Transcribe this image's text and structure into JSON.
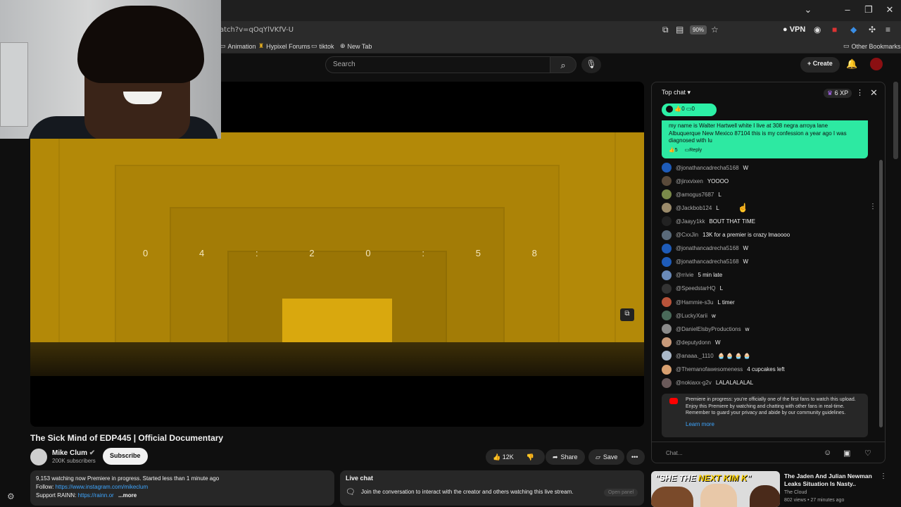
{
  "browser": {
    "url": "atch?v=qOqYlVKfV-U",
    "zoom": "90%",
    "vpn": "VPN",
    "bookmarks": [
      "Animation",
      "Hypixel Forums",
      "tiktok",
      "New Tab"
    ],
    "other_bookmarks": "Other Bookmarks"
  },
  "header": {
    "search_placeholder": "Search",
    "create_label": "Create"
  },
  "player": {
    "countdown": [
      "0",
      "4",
      ":",
      "2",
      "0",
      ":",
      "5",
      "8"
    ]
  },
  "video": {
    "title": "The Sick Mind of EDP445 | Official Documentary",
    "channel": "Mike Clum",
    "subscribers": "200K subscribers",
    "subscribe_label": "Subscribe",
    "likes": "12K",
    "share_label": "Share",
    "save_label": "Save",
    "description": {
      "line1": "9,153 watching now  Premiere in progress. Started less than 1 minute ago",
      "follow_label": "Follow: ",
      "follow_link": "https://www.instagram.com/mikeclum",
      "support_label": "Support RAINN: ",
      "support_link": "https://rainn.or",
      "more": "...more"
    },
    "live_chat_box": {
      "title": "Live chat",
      "text": "Join the conversation to interact with the creator and others watching this live stream.",
      "open_panel": "Open panel"
    }
  },
  "chat": {
    "header": "Top chat",
    "xp": "6 XP",
    "poll_likes": "0",
    "poll_replies": "0",
    "pinned": {
      "text": "my name is Walter Hartwell white I live at 308 negra arroya lane Albuquerque New Mexico 87104 this is my confession a year ago I was diagnosed with lu",
      "likes": "5",
      "reply": "Reply"
    },
    "messages": [
      {
        "author": "@jonathancadrecha5168",
        "text": "W",
        "color": "#1e5bb8"
      },
      {
        "author": "@jinxvixen",
        "text": "YOOOO",
        "color": "#5a4a3a"
      },
      {
        "author": "@amogus7687",
        "text": "L",
        "color": "#7a8a4a"
      },
      {
        "author": "@Jackbob124",
        "text": "L",
        "color": "#9a8a6a"
      },
      {
        "author": "@Jaayy1kk",
        "text": "BOUT THAT TIME",
        "color": "#222222"
      },
      {
        "author": "@CxxJin",
        "text": "13K for a premier is crazy lmaoooo",
        "color": "#5a6a7a"
      },
      {
        "author": "@jonathancadrecha5168",
        "text": "W",
        "color": "#1e5bb8"
      },
      {
        "author": "@jonathancadrecha5168",
        "text": "W",
        "color": "#1e5bb8"
      },
      {
        "author": "@rrivie",
        "text": "5 min late",
        "color": "#6a8ab8"
      },
      {
        "author": "@SpeedstarHQ",
        "text": "L",
        "color": "#333333"
      },
      {
        "author": "@Hammie-s3u",
        "text": "L timer",
        "color": "#b8533a"
      },
      {
        "author": "@LuckyXarii",
        "text": "w",
        "color": "#4a6a5a"
      },
      {
        "author": "@DanielElsbyProductions",
        "text": "w",
        "color": "#8a8a8a"
      },
      {
        "author": "@deputydonn",
        "text": "W",
        "color": "#c89a7a"
      },
      {
        "author": "@anaaa._1110",
        "text": "🧁 🧁 🧁 🧁",
        "color": "#aab8c8"
      },
      {
        "author": "@Themanofawesomeness",
        "text": "4 cupcakes left",
        "color": "#d8a070"
      },
      {
        "author": "@nokiaxx-g2v",
        "text": "LALALALALAL",
        "color": "#6a5a5a"
      }
    ],
    "premiere_note": "Premiere in progress: you're officially one of the first fans to watch this upload. Enjoy this Premiere by watching and chatting with other fans in real-time. Remember to guard your privacy and abide by our community guidelines.",
    "learn_more": "Learn more",
    "input_placeholder": "Chat..."
  },
  "recommended": {
    "thumb_caption_a": "\"SHE THE ",
    "thumb_caption_b": "NEXT KIM K",
    "thumb_caption_c": "\"",
    "title": "The Jaden And Julian Newman Leaks Situation Is Nasty..",
    "channel": "The Cloud",
    "meta": "802 views • 27 minutes ago"
  }
}
